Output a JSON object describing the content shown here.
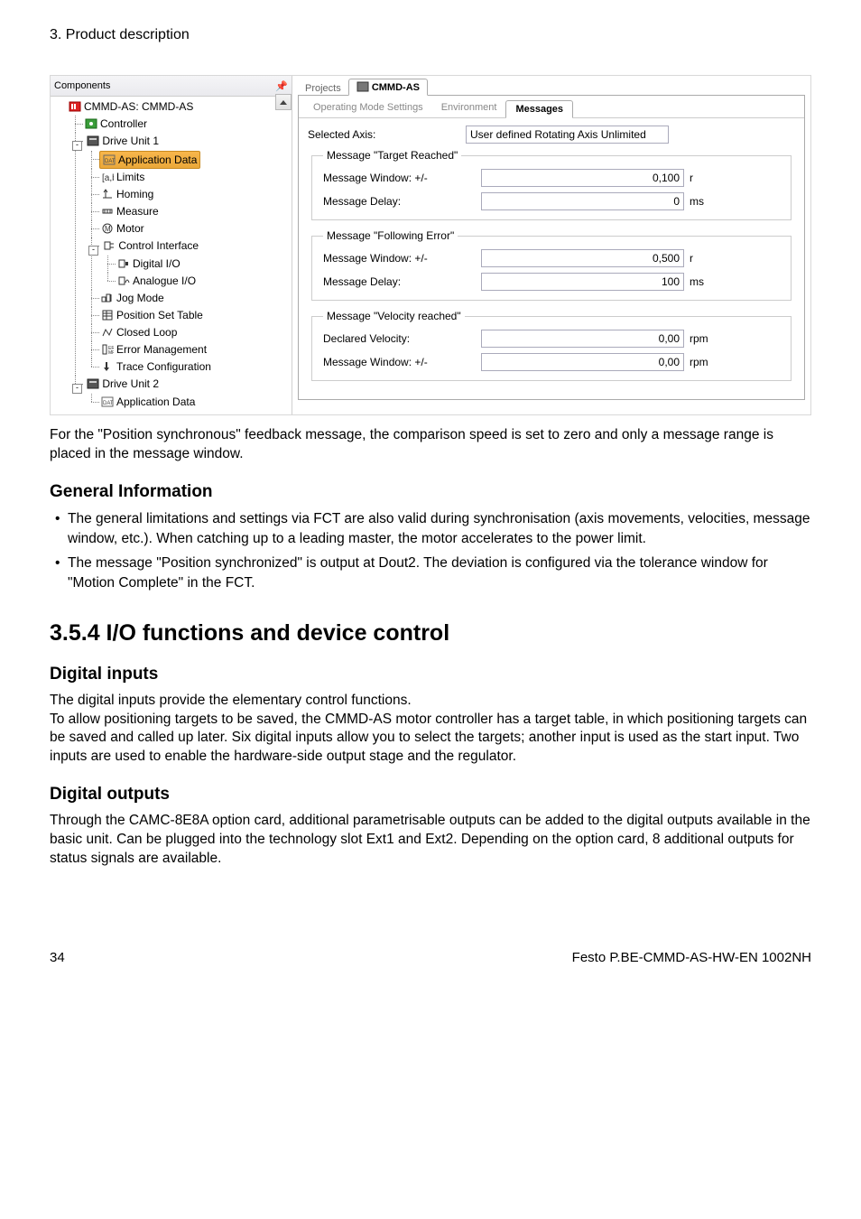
{
  "page_header": "3. Product description",
  "screenshot": {
    "left_title": "Components",
    "tree": {
      "root": "CMMD-AS: CMMD-AS",
      "controller": "Controller",
      "du1": "Drive Unit 1",
      "appdata": "Application Data",
      "limits": "Limits",
      "homing": "Homing",
      "measure": "Measure",
      "motor": "Motor",
      "ci": "Control Interface",
      "digio": "Digital I/O",
      "anaio": "Analogue I/O",
      "jog": "Jog Mode",
      "pst": "Position Set Table",
      "closed": "Closed Loop",
      "errmgmt": "Error Management",
      "trace": "Trace Configuration",
      "du2": "Drive Unit 2",
      "appdata2": "Application Data"
    },
    "top_tabs": {
      "projects": "Projects",
      "device": "CMMD-AS"
    },
    "subtabs": {
      "oms": "Operating Mode Settings",
      "env": "Environment",
      "msgs": "Messages"
    },
    "selected_axis_lbl": "Selected Axis:",
    "selected_axis_val": "User defined Rotating Axis Unlimited",
    "grp_target": "Message \"Target Reached\"",
    "grp_follow": "Message \"Following Error\"",
    "grp_vel": "Message \"Velocity reached\"",
    "mw_lbl": "Message Window: +/-",
    "md_lbl": "Message Delay:",
    "dv_lbl": "Declared Velocity:",
    "vals": {
      "tr_win": "0,100",
      "tr_win_u": "r",
      "tr_del": "0",
      "tr_del_u": "ms",
      "fe_win": "0,500",
      "fe_win_u": "r",
      "fe_del": "100",
      "fe_del_u": "ms",
      "vr_dec": "0,00",
      "vr_dec_u": "rpm",
      "vr_win": "0,00",
      "vr_win_u": "rpm"
    }
  },
  "doc": {
    "p1": "For the \"Position synchronous\" feedback message, the comparison speed is set to zero and only a message range is placed in the message window.",
    "h_gi": "General Information",
    "li1": "The general limitations and settings via FCT are also valid during synchronisation (axis movements, velocities, message window, etc.). When catching up to a leading master, the motor accelerates to the power limit.",
    "li2": "The message \"Position synchronized\" is output at Dout2. The deviation is configured via the tolerance window for \"Motion Complete\" in the FCT.",
    "h_354": "3.5.4    I/O functions and device control",
    "h_di": "Digital inputs",
    "p_di": "The digital inputs provide the elementary control functions.\nTo allow positioning targets to be saved, the CMMD-AS motor controller has a target table, in which positioning targets can be saved and called up later. Six digital inputs allow you to select the targets; another input is used as the start input. Two inputs are used to enable the hardware-side output stage and the regulator.",
    "h_do": "Digital outputs",
    "p_do": "Through the CAMC-8E8A option card, additional parametrisable outputs can be added to the digital outputs available in the basic unit. Can be plugged into the technology slot Ext1 and Ext2. Depending on the option card, 8 additional outputs for status signals are available.",
    "page_num": "34",
    "footer_r": "Festo P.BE-CMMD-AS-HW-EN 1002NH"
  }
}
